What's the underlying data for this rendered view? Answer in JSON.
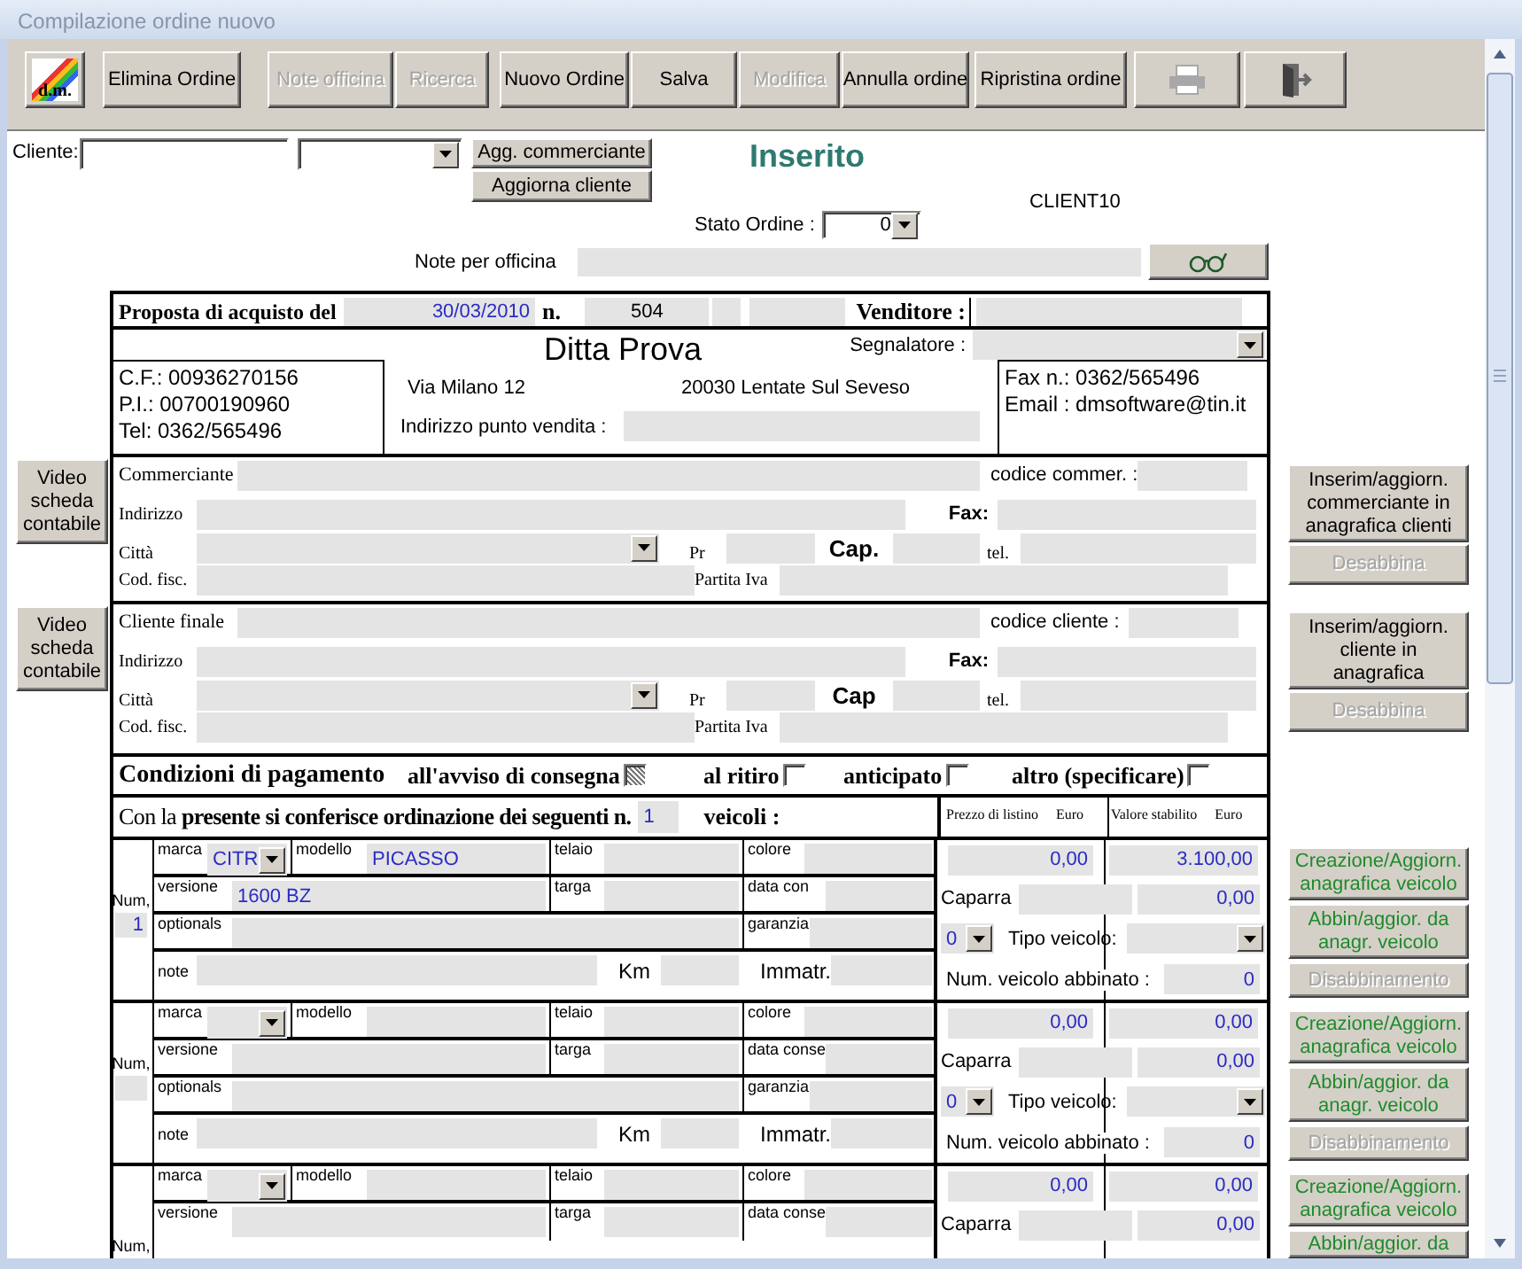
{
  "window": {
    "title": "Compilazione ordine nuovo"
  },
  "toolbar": [
    {
      "kind": "logo",
      "label": "d.m.",
      "disabled": false
    },
    {
      "kind": "text",
      "label": "Elimina Ordine",
      "disabled": false
    },
    {
      "kind": "text",
      "label": "Note officina",
      "disabled": true
    },
    {
      "kind": "text",
      "label": "Ricerca",
      "disabled": true
    },
    {
      "kind": "text",
      "label": "Nuovo Ordine",
      "disabled": false
    },
    {
      "kind": "text",
      "label": "Salva",
      "disabled": false
    },
    {
      "kind": "text",
      "label": "Modifica",
      "disabled": true
    },
    {
      "kind": "text",
      "label": "Annulla ordine",
      "disabled": false
    },
    {
      "kind": "text",
      "label": "Ripristina ordine",
      "disabled": false
    },
    {
      "kind": "print",
      "disabled": true
    },
    {
      "kind": "exit",
      "disabled": false
    }
  ],
  "client_bar": {
    "label": "Cliente:",
    "buttons": [
      "Agg. commerciante",
      "Aggiorna cliente"
    ]
  },
  "status": "Inserito",
  "user": "CLIENT10",
  "stato_ordine": {
    "label": "Stato Ordine :",
    "value": "0"
  },
  "note_officina": {
    "label": "Note per officina"
  },
  "proposta": {
    "label": "Proposta di acquisto del",
    "date": "30/03/2010",
    "number_label": "n.",
    "number": "504",
    "venditore_label": "Venditore :"
  },
  "company": {
    "name": "Ditta Prova",
    "segnalatore_label": "Segnalatore :",
    "left_lines": [
      "C.F.: 00936270156",
      "P.I.: 00700190960",
      "Tel: 0362/565496"
    ],
    "street": "Via Milano 12",
    "city": "20030 Lentate Sul Seveso",
    "punto_vendita_label": "Indirizzo punto vendita :",
    "right_lines": [
      "Fax n.: 0362/565496",
      "Email : dmsoftware@tin.it"
    ]
  },
  "parties": [
    {
      "side_button": "Video scheda contabile",
      "title": "Commerciante",
      "code_label": "codice commer. :",
      "indirizzo_label": "Indirizzo",
      "fax_label": "Fax:",
      "citta_label": "Città",
      "pr_label": "Pr",
      "cap_label": "Cap.",
      "tel_label": "tel.",
      "cf_label": "Cod. fisc.",
      "piva_label": "Partita Iva",
      "buttons": [
        {
          "label": "Inserim/aggiorn. commerciante in anagrafica clienti",
          "disabled": false
        },
        {
          "label": "Desabbina",
          "disabled": true
        }
      ]
    },
    {
      "side_button": "Video scheda contabile",
      "title": "Cliente finale",
      "code_label": "codice cliente :",
      "indirizzo_label": "Indirizzo",
      "fax_label": "Fax:",
      "citta_label": "Città",
      "pr_label": "Pr",
      "cap_label": "Cap",
      "tel_label": "tel.",
      "cf_label": "Cod. fisc.",
      "piva_label": "Partita Iva",
      "buttons": [
        {
          "label": "Inserim/aggiorn. cliente in anagrafica",
          "disabled": false
        },
        {
          "label": "Desabbina",
          "disabled": true
        }
      ]
    }
  ],
  "payment": {
    "label": "Condizioni di pagamento",
    "options": [
      {
        "label": "all'avviso di consegna",
        "checked": true
      },
      {
        "label": "al ritiro",
        "checked": false
      },
      {
        "label": "anticipato",
        "checked": false
      },
      {
        "label": "altro (specificare)",
        "checked": false
      }
    ]
  },
  "vehicles_header": {
    "text": "Con la **presente si conferisce ordinazione dei seguenti n.**",
    "count": "1",
    "suffix": "veicoli :",
    "price_headers": [
      {
        "label": "Prezzo di listino",
        "unit": "Euro"
      },
      {
        "label": "Valore stabilito",
        "unit": "Euro"
      }
    ]
  },
  "vehicles": [
    {
      "num_label": "Num,",
      "num": "1",
      "lines": [
        {
          "fields": [
            {
              "label": "marca",
              "value": "CITR"
            },
            {
              "label": "modello",
              "value": "PICASSO"
            },
            {
              "label": "telaio"
            },
            {
              "label": "colore"
            }
          ]
        },
        {
          "fields": [
            {
              "label": "versione",
              "value": "1600 BZ"
            },
            {
              "label": "targa"
            },
            {
              "label": "data con"
            }
          ]
        },
        {
          "fields": [
            {
              "label": "optionals"
            },
            {
              "label": "garanzia"
            }
          ]
        },
        {
          "fields": [
            {
              "label": "note"
            },
            {
              "label": "Km"
            },
            {
              "label": "Immatr."
            }
          ]
        }
      ],
      "prices": {
        "listino": "0,00",
        "valore": "3.100,00",
        "caparra_label": "Caparra",
        "caparra": "0,00",
        "tipo_count": "0",
        "tipo_label": "Tipo veicolo:",
        "abbinato_label": "Num. veicolo abbinato :",
        "abbinato": "0"
      },
      "buttons": [
        {
          "label": "Creazione/Aggiorn. anagrafica veicolo",
          "disabled": false
        },
        {
          "label": "Abbin/aggior. da anagr. veicolo",
          "disabled": false
        },
        {
          "label": "Disabbinamento",
          "disabled": true
        }
      ]
    },
    {
      "num_label": "Num,",
      "lines": [
        {
          "fields": [
            {
              "label": "marca"
            },
            {
              "label": "modello"
            },
            {
              "label": "telaio"
            },
            {
              "label": "colore"
            }
          ]
        },
        {
          "fields": [
            {
              "label": "versione"
            },
            {
              "label": "targa"
            },
            {
              "label": "data conse"
            }
          ]
        },
        {
          "fields": [
            {
              "label": "optionals"
            },
            {
              "label": "garanzia"
            }
          ]
        },
        {
          "fields": [
            {
              "label": "note"
            },
            {
              "label": "Km"
            },
            {
              "label": "Immatr."
            }
          ]
        }
      ],
      "prices": {
        "listino": "0,00",
        "valore": "0,00",
        "caparra_label": "Caparra",
        "caparra": "0,00",
        "tipo_count": "0",
        "tipo_label": "Tipo veicolo:",
        "abbinato_label": "Num. veicolo abbinato :",
        "abbinato": "0"
      },
      "buttons": [
        {
          "label": "Creazione/Aggiorn. anagrafica veicolo",
          "disabled": false
        },
        {
          "label": "Abbin/aggior. da anagr. veicolo",
          "disabled": false
        },
        {
          "label": "Disabbinamento",
          "disabled": true
        }
      ]
    },
    {
      "num_label": "Num,",
      "lines": [
        {
          "fields": [
            {
              "label": "marca"
            },
            {
              "label": "modello"
            },
            {
              "label": "telaio"
            },
            {
              "label": "colore"
            }
          ]
        },
        {
          "fields": [
            {
              "label": "versione"
            },
            {
              "label": "targa"
            },
            {
              "label": "data conse"
            }
          ]
        }
      ],
      "prices": {
        "listino": "0,00",
        "valore": "0,00",
        "caparra_label": "Caparra",
        "caparra": "0,00"
      },
      "buttons": [
        {
          "label": "Creazione/Aggiorn. anagrafica veicolo",
          "disabled": false
        },
        {
          "label": "Abbin/aggior. da",
          "disabled": false
        }
      ]
    }
  ]
}
